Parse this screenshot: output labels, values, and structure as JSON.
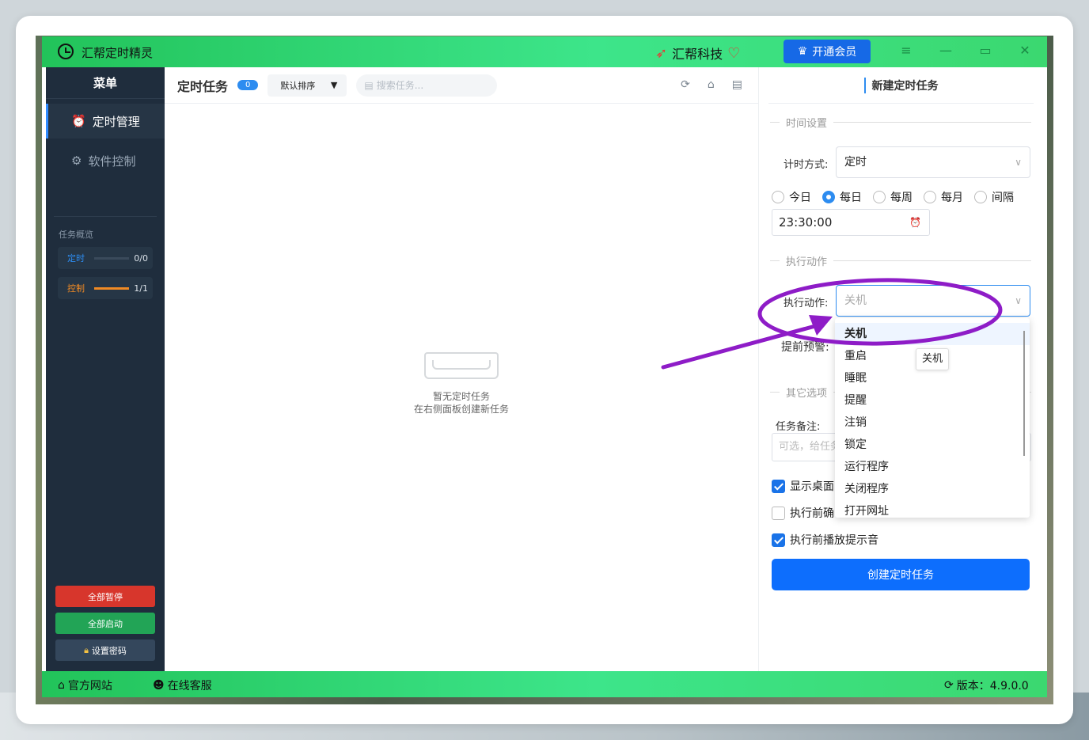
{
  "app": {
    "title": "汇帮定时精灵",
    "brand": "汇帮科技",
    "vip_label": "开通会员"
  },
  "sidebar": {
    "header": "菜单",
    "items": [
      {
        "label": "定时管理",
        "icon": "alarm-clock-icon",
        "active": true
      },
      {
        "label": "软件控制",
        "icon": "gear-icon",
        "active": false
      }
    ],
    "overview_title": "任务概览",
    "overview": [
      {
        "label": "定时",
        "count": "0/0",
        "progress": 0,
        "color": "#2d8cf0"
      },
      {
        "label": "控制",
        "count": "1/1",
        "progress": 1,
        "color": "#f08a24"
      }
    ],
    "buttons": {
      "pause_all": "全部暂停",
      "start_all": "全部启动",
      "set_password": "设置密码"
    }
  },
  "main": {
    "title": "定时任务",
    "badge": "0",
    "sort_label": "默认排序",
    "search_placeholder": "搜索任务...",
    "empty_line1": "暂无定时任务",
    "empty_line2": "在右侧面板创建新任务"
  },
  "panel": {
    "title": "新建定时任务",
    "section_time": "时间设置",
    "timing_label": "计时方式:",
    "timing_value": "定时",
    "radios": [
      {
        "label": "今日",
        "checked": false
      },
      {
        "label": "每日",
        "checked": true
      },
      {
        "label": "每周",
        "checked": false
      },
      {
        "label": "每月",
        "checked": false
      },
      {
        "label": "间隔",
        "checked": false
      }
    ],
    "time_value": "23:30:00",
    "section_action": "执行动作",
    "action_label": "执行动作:",
    "action_placeholder": "关机",
    "warn_label": "提前预警:",
    "section_other": "其它选项",
    "note_label": "任务备注:",
    "note_placeholder": "可选，给任务",
    "check_desktop": "显示桌面",
    "check_confirm": "执行前确",
    "check_sound": "执行前播放提示音",
    "create_button": "创建定时任务"
  },
  "dropdown": {
    "options": [
      "关机",
      "重启",
      "睡眠",
      "提醒",
      "注销",
      "锁定",
      "运行程序",
      "关闭程序",
      "打开网址"
    ],
    "selected": "关机",
    "tooltip": "关机"
  },
  "footer": {
    "website": "官方网站",
    "service": "在线客服",
    "version": "版本：4.9.0.0"
  },
  "colors": {
    "green_bar": "#3de58a",
    "sidebar_bg": "#1f2d3d",
    "primary": "#0d6efd",
    "annotation": "#8e1cc7"
  }
}
